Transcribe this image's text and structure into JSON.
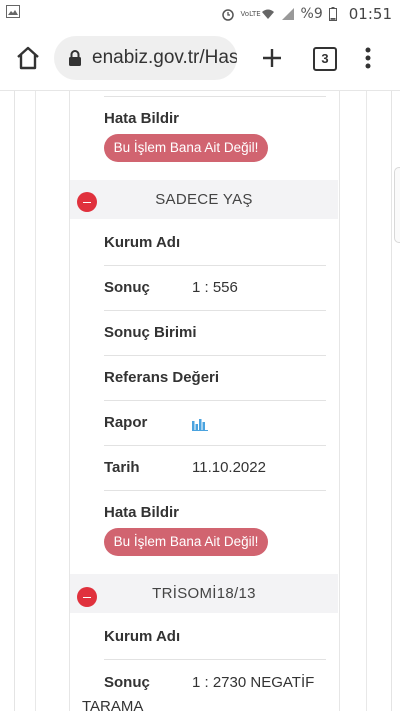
{
  "status_bar": {
    "time": "01:51",
    "battery": "%9",
    "network": "VoLTE"
  },
  "browser": {
    "url": "enabiz.gov.tr/Has",
    "tab_count": "3"
  },
  "top_block": {
    "hata_label": "Hata Bildir",
    "report_button": "Bu İşlem Bana Ait Değil!"
  },
  "sections": [
    {
      "title": "SADECE YAŞ",
      "rows": {
        "kurum": "Kurum Adı",
        "sonuc": "Sonuç",
        "sonuc_value": "1 : 556",
        "birim": "Sonuç Birimi",
        "referans": "Referans Değeri",
        "rapor": "Rapor",
        "tarih": "Tarih",
        "tarih_value": "11.10.2022",
        "hata": "Hata Bildir"
      },
      "report_button": "Bu İşlem Bana Ait Değil!"
    },
    {
      "title": "TRİSOMİ18/13",
      "rows": {
        "kurum": "Kurum Adı",
        "sonuc": "Sonuç",
        "sonuc_value": "1 : 2730 NEGATİF",
        "sonuc_value_wrap": "TARAMA"
      }
    }
  ],
  "colors": {
    "report_button": "#d16470",
    "collapse_icon": "#e0313d",
    "section_header_bg": "#f3f3f5"
  }
}
